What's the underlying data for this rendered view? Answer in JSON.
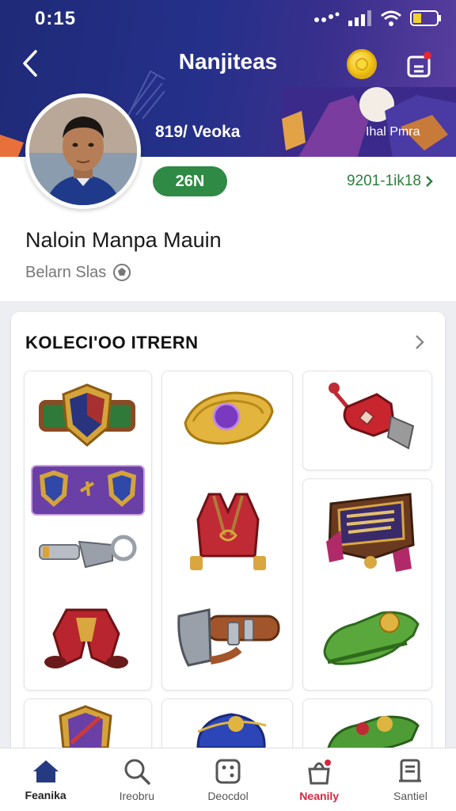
{
  "status_bar": {
    "time": "0:15"
  },
  "header": {
    "title": "Nanjiteas",
    "stat_left": "819/ Veoka",
    "stat_right": "Ihal Pmra"
  },
  "profile": {
    "level": "26N",
    "points": "9201-1ik18",
    "name": "Naloin Manpa Mauin",
    "subtitle": "Belarn Slas"
  },
  "collection": {
    "title": "KOLECI'OO ITRERN"
  },
  "bottom_nav": [
    {
      "label": "Feanika",
      "icon": "home-icon"
    },
    {
      "label": "Ireobru",
      "icon": "search-icon"
    },
    {
      "label": "Deocdol",
      "icon": "dice-icon"
    },
    {
      "label": "Neanily",
      "icon": "bag-icon"
    },
    {
      "label": "Santiel",
      "icon": "list-icon"
    }
  ],
  "colors": {
    "header": "#25308a",
    "level_badge": "#2e8a45",
    "points": "#2b7f3c",
    "alert": "#d7263d"
  }
}
